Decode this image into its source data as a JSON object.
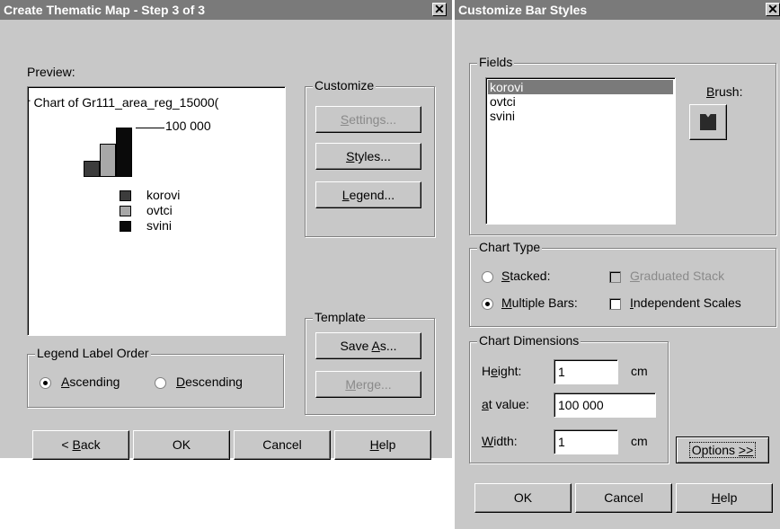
{
  "dlg1": {
    "title": "Create Thematic Map - Step 3 of 3",
    "preview_label": "Preview:",
    "preview_chart_title": "r Chart of Gr111_area_reg_15000(",
    "preview_scale_value": "100 000",
    "legend_items": [
      {
        "label": "korovi",
        "color": "#3c3c3c"
      },
      {
        "label": "ovtci",
        "color": "#a8a8a8"
      },
      {
        "label": "svini",
        "color": "#0a0a0a"
      }
    ],
    "customize_group": "Customize",
    "settings_btn": "Settings...",
    "styles_btn": "Styles...",
    "legend_btn": "Legend...",
    "template_group": "Template",
    "saveas_btn": "Save As...",
    "merge_btn": "Merge...",
    "legend_order_group": "Legend Label Order",
    "ascending": "Ascending",
    "descending": "Descending",
    "back_btn": "< Back",
    "ok_btn": "OK",
    "cancel_btn": "Cancel",
    "help_btn": "Help"
  },
  "dlg2": {
    "title": "Customize Bar Styles",
    "fields_group": "Fields",
    "fields": [
      "korovi",
      "ovtci",
      "svini"
    ],
    "selected_field": "korovi",
    "brush_label": "Brush:",
    "chart_type_group": "Chart Type",
    "stacked": "Stacked:",
    "graduated_stack": "Graduated Stack",
    "multiple_bars": "Multiple Bars:",
    "independent_scales": "Independent Scales",
    "dimensions_group": "Chart Dimensions",
    "height_label": "Height:",
    "height_value": "1",
    "height_unit": "cm",
    "at_value_label": "at value:",
    "at_value": "100 000",
    "width_label": "Width:",
    "width_value": "1",
    "width_unit": "cm",
    "options_btn": "Options >>",
    "ok_btn": "OK",
    "cancel_btn": "Cancel",
    "help_btn": "Help"
  }
}
